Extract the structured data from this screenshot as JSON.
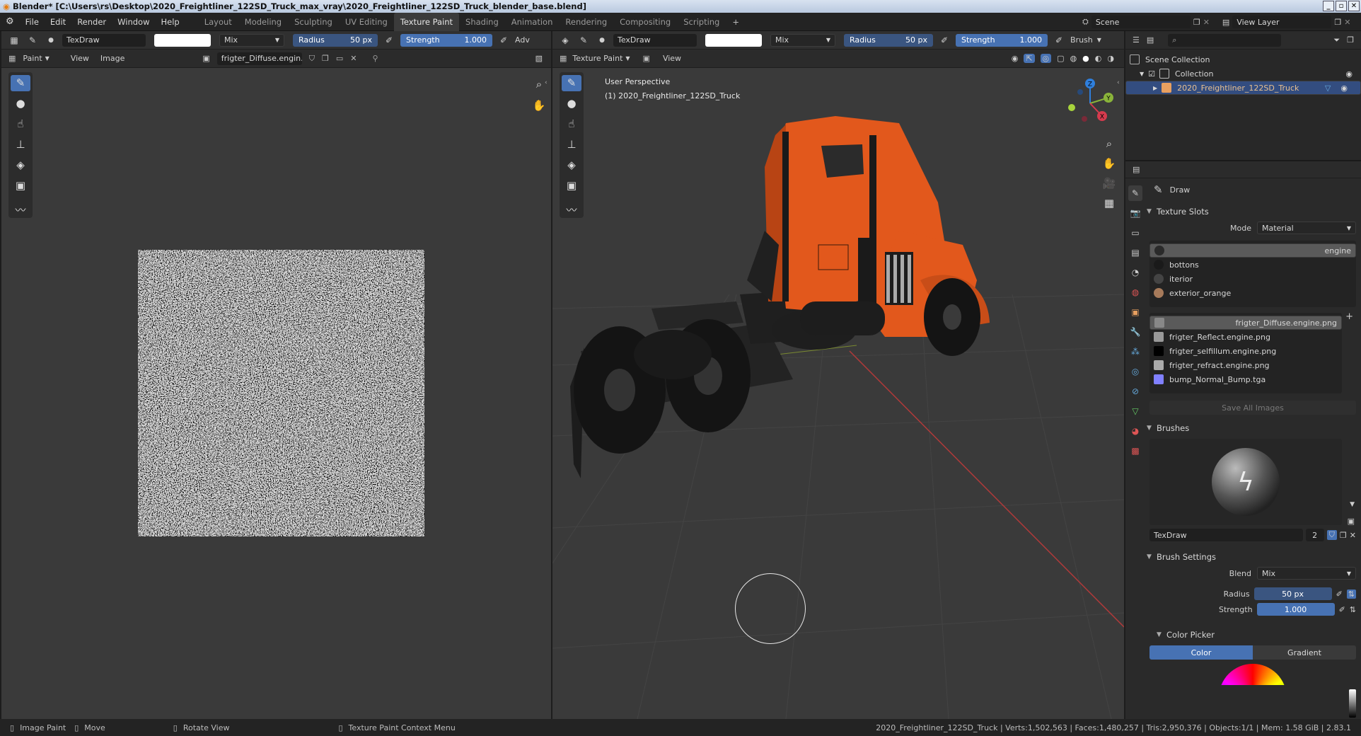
{
  "window": {
    "title": "Blender* [C:\\Users\\rs\\Desktop\\2020_Freightliner_122SD_Truck_max_vray\\2020_Freightliner_122SD_Truck_blender_base.blend]"
  },
  "menu": {
    "items": [
      "File",
      "Edit",
      "Render",
      "Window",
      "Help"
    ]
  },
  "workspaces": {
    "tabs": [
      "Layout",
      "Modeling",
      "Sculpting",
      "UV Editing",
      "Texture Paint",
      "Shading",
      "Animation",
      "Rendering",
      "Compositing",
      "Scripting"
    ],
    "active": "Texture Paint",
    "add": "+"
  },
  "scene": {
    "name": "Scene",
    "view_layer": "View Layer"
  },
  "image_editor": {
    "brush_name": "TexDraw",
    "blend": "Mix",
    "radius_label": "Radius",
    "radius_value": "50 px",
    "strength_label": "Strength",
    "strength_value": "1.000",
    "adv_label": "Adv",
    "mode": "Paint",
    "menus": [
      "View",
      "Image"
    ],
    "image_name": "frigter_Diffuse.engin..."
  },
  "viewport": {
    "brush_name": "TexDraw",
    "blend": "Mix",
    "radius_label": "Radius",
    "radius_value": "50 px",
    "strength_label": "Strength",
    "strength_value": "1.000",
    "brush_menu": "Brush",
    "mode": "Texture Paint",
    "view_menu": "View",
    "overlay_title": "User Perspective",
    "overlay_object": "(1) 2020_Freightliner_122SD_Truck",
    "gizmo": {
      "x": "X",
      "y": "Y",
      "z": "Z"
    }
  },
  "outliner": {
    "scene_collection": "Scene Collection",
    "collection": "Collection",
    "object": "2020_Freightliner_122SD_Truck"
  },
  "properties": {
    "tool_name": "Draw",
    "texture_slots": {
      "title": "Texture Slots",
      "mode_label": "Mode",
      "mode_value": "Material",
      "materials": [
        "engine",
        "bottons",
        "iterior",
        "exterior_orange"
      ],
      "images": [
        "frigter_Diffuse.engine.png",
        "frigter_Reflect.engine.png",
        "frigter_selfillum.engine.png",
        "frigter_refract.engine.png",
        "bump_Normal_Bump.tga"
      ],
      "save_all": "Save All Images"
    },
    "brushes": {
      "title": "Brushes",
      "brush_name": "TexDraw",
      "users": "2"
    },
    "brush_settings": {
      "title": "Brush Settings",
      "blend_label": "Blend",
      "blend_value": "Mix",
      "radius_label": "Radius",
      "radius_value": "50 px",
      "strength_label": "Strength",
      "strength_value": "1.000",
      "color_picker": "Color Picker",
      "color_tab": "Color",
      "gradient_tab": "Gradient"
    }
  },
  "statusbar": {
    "image_paint": "Image Paint",
    "move": "Move",
    "rotate_view": "Rotate View",
    "context_menu": "Texture Paint Context Menu",
    "stats": "2020_Freightliner_122SD_Truck | Verts:1,502,563 | Faces:1,480,257 | Tris:2,950,376 | Objects:1/1 | Mem: 1.58 GiB | 2.83.1"
  },
  "colors": {
    "accent": "#4772b3",
    "truck_orange": "#e2581c",
    "selection_orange": "#e8a060"
  }
}
